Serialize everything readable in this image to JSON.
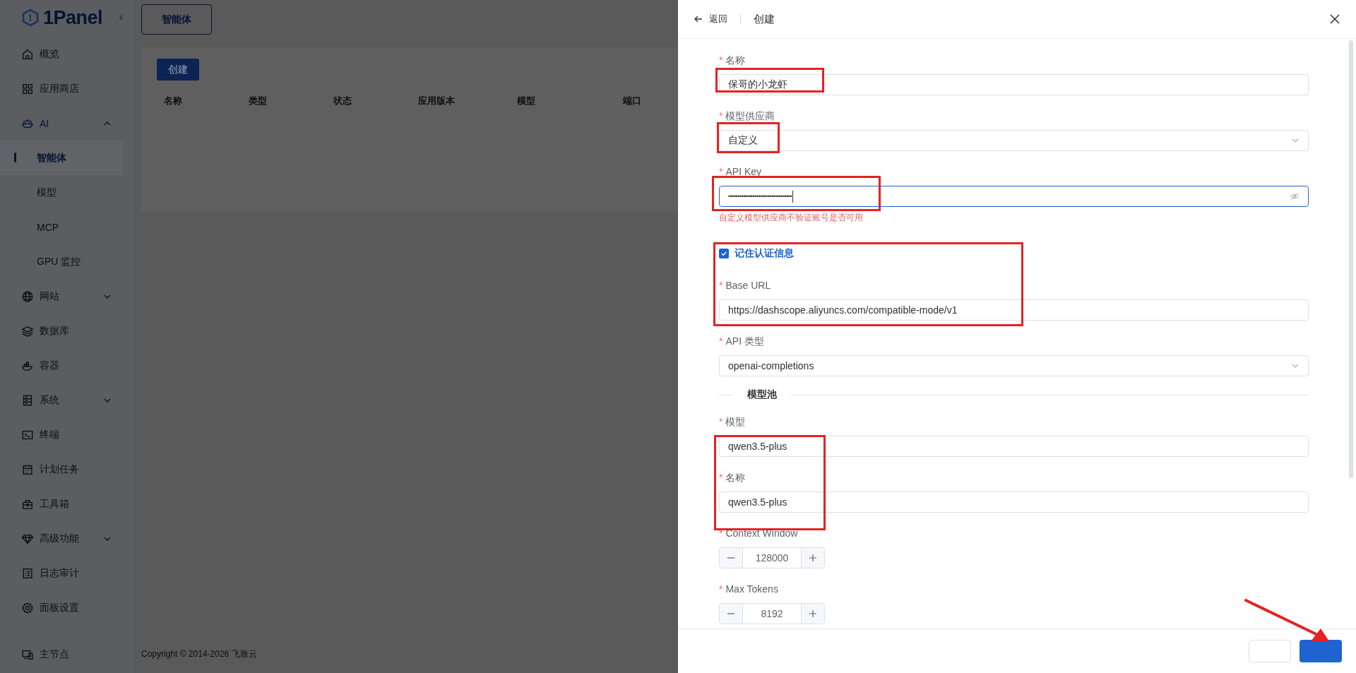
{
  "sidebar": {
    "logo": "1Panel",
    "items": [
      {
        "label": "概览",
        "selected": false
      },
      {
        "label": "应用商店",
        "selected": false
      },
      {
        "label": "AI",
        "selected": false,
        "expanded": true,
        "children": [
          {
            "label": "智能体",
            "selected": true
          },
          {
            "label": "模型",
            "selected": false
          },
          {
            "label": "MCP",
            "selected": false
          },
          {
            "label": "GPU 监控",
            "selected": false
          }
        ]
      },
      {
        "label": "网站",
        "selected": false,
        "expanded": false
      },
      {
        "label": "数据库",
        "selected": false
      },
      {
        "label": "容器",
        "selected": false
      },
      {
        "label": "系统",
        "selected": false,
        "expanded": false
      },
      {
        "label": "终端",
        "selected": false
      },
      {
        "label": "计划任务",
        "selected": false
      },
      {
        "label": "工具箱",
        "selected": false
      },
      {
        "label": "高级功能",
        "selected": false,
        "expanded": false
      },
      {
        "label": "日志审计",
        "selected": false
      },
      {
        "label": "面板设置",
        "selected": false
      }
    ],
    "node": {
      "label": "主节点",
      "selected": false
    }
  },
  "main": {
    "tabs": [
      {
        "label": "智能体",
        "selected": true
      }
    ],
    "create_button": "创建",
    "table": {
      "columns": [
        "名称",
        "类型",
        "状态",
        "应用版本",
        "模型",
        "端口"
      ]
    },
    "copyright": "Copyright © 2014-2026 飞致云"
  },
  "drawer": {
    "back": "返回",
    "title": "创建",
    "required_mark": "*",
    "fields": [
      {
        "kind": "text",
        "label": "名称",
        "required": true,
        "value": "保哥的小龙虾"
      },
      {
        "kind": "select",
        "label": "模型供应商",
        "required": true,
        "value": "自定义"
      },
      {
        "kind": "password",
        "label": "API Key",
        "required": true,
        "value": "••••••••••••••••••••••••••••••••••",
        "focused": true,
        "hint": "自定义模型供应商不验证账号是否可用"
      },
      {
        "kind": "checkbox",
        "label": "记住认证信息",
        "checked": true
      },
      {
        "kind": "text",
        "label": "Base URL",
        "required": true,
        "value": "https://dashscope.aliyuncs.com/compatible-mode/v1"
      },
      {
        "kind": "select",
        "label": "API 类型",
        "required": true,
        "value": "openai-completions"
      },
      {
        "kind": "divider",
        "label": "模型池"
      },
      {
        "kind": "text",
        "label": "模型",
        "required": true,
        "value": "qwen3.5-plus"
      },
      {
        "kind": "text",
        "label": "名称",
        "required": true,
        "value": "qwen3.5-plus"
      },
      {
        "kind": "number",
        "label": "Context Window",
        "required": true,
        "value": "128000"
      },
      {
        "kind": "number",
        "label": "Max Tokens",
        "required": true,
        "value": "8192"
      }
    ]
  }
}
